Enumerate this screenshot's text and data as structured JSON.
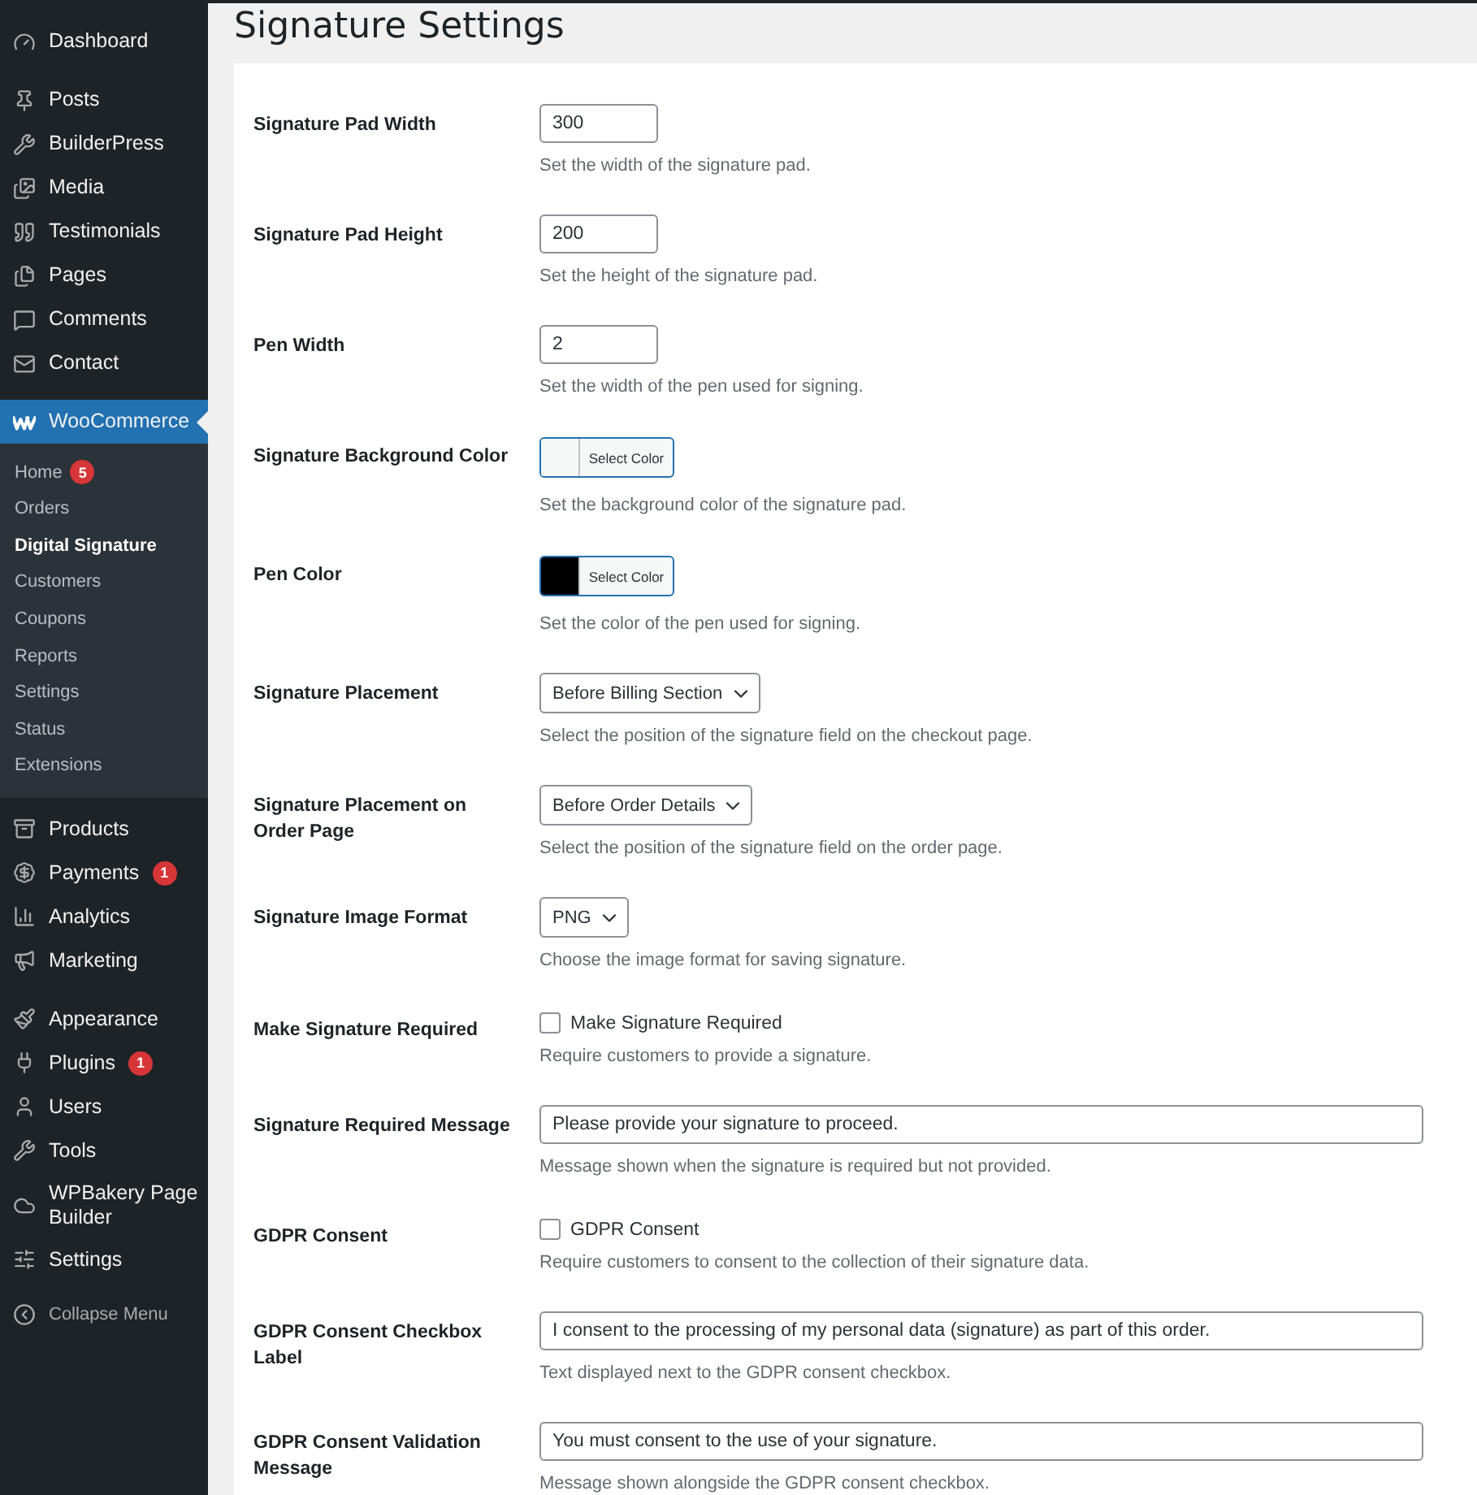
{
  "sidebar": {
    "groups": [
      [
        {
          "label": "Dashboard",
          "selected": false
        }
      ],
      [
        {
          "label": "Posts",
          "selected": false
        },
        {
          "label": "BuilderPress",
          "selected": false
        },
        {
          "label": "Media",
          "selected": false
        },
        {
          "label": "Testimonials",
          "selected": false
        },
        {
          "label": "Pages",
          "selected": false
        },
        {
          "label": "Comments",
          "selected": false
        },
        {
          "label": "Contact",
          "selected": false
        }
      ],
      [
        {
          "label": "WooCommerce",
          "selected": true,
          "children": [
            {
              "label": "Home",
              "badge": "5",
              "selected": false
            },
            {
              "label": "Orders",
              "selected": false
            },
            {
              "label": "Digital Signature",
              "selected": true
            },
            {
              "label": "Customers",
              "selected": false
            },
            {
              "label": "Coupons",
              "selected": false
            },
            {
              "label": "Reports",
              "selected": false
            },
            {
              "label": "Settings",
              "selected": false
            },
            {
              "label": "Status",
              "selected": false
            },
            {
              "label": "Extensions",
              "selected": false
            }
          ]
        },
        {
          "label": "Products",
          "selected": false
        },
        {
          "label": "Payments",
          "badge": "1",
          "selected": false
        },
        {
          "label": "Analytics",
          "selected": false
        },
        {
          "label": "Marketing",
          "selected": false
        }
      ],
      [
        {
          "label": "Appearance",
          "selected": false
        },
        {
          "label": "Plugins",
          "badge": "1",
          "selected": false
        },
        {
          "label": "Users",
          "selected": false
        },
        {
          "label": "Tools",
          "selected": false
        },
        {
          "label": "WPBakery Page Builder",
          "selected": false
        },
        {
          "label": "Settings",
          "selected": false
        }
      ]
    ],
    "collapse": "Collapse Menu"
  },
  "page": {
    "title": "Signature Settings"
  },
  "settings": [
    {
      "kind": "number",
      "label": "Signature Pad Width",
      "value": "300",
      "description": "Set the width of the signature pad."
    },
    {
      "kind": "number",
      "label": "Signature Pad Height",
      "value": "200",
      "description": "Set the height of the signature pad."
    },
    {
      "kind": "number",
      "label": "Pen Width",
      "value": "2",
      "description": "Set the width of the pen used for signing."
    },
    {
      "kind": "color",
      "label": "Signature Background Color",
      "button": "Select Color",
      "color": "#f6f7f7",
      "description": "Set the background color of the signature pad."
    },
    {
      "kind": "color",
      "label": "Pen Color",
      "button": "Select Color",
      "color": "#000000",
      "description": "Set the color of the pen used for signing."
    },
    {
      "kind": "select",
      "label": "Signature Placement",
      "value": "Before Billing Section",
      "description": "Select the position of the signature field on the checkout page."
    },
    {
      "kind": "select",
      "label": "Signature Placement on Order Page",
      "value": "Before Order Details",
      "description": "Select the position of the signature field on the order page."
    },
    {
      "kind": "select",
      "label": "Signature Image Format",
      "value": "PNG",
      "description": "Choose the image format for saving signature."
    },
    {
      "kind": "checkbox",
      "label": "Make Signature Required",
      "option": "Make Signature Required",
      "checked": false,
      "description": "Require customers to provide a signature."
    },
    {
      "kind": "text",
      "label": "Signature Required Message",
      "value": "Please provide your signature to proceed.",
      "description": "Message shown when the signature is required but not provided."
    },
    {
      "kind": "checkbox",
      "label": "GDPR Consent",
      "option": "GDPR Consent",
      "checked": false,
      "description": "Require customers to consent to the collection of their signature data."
    },
    {
      "kind": "text",
      "label": "GDPR Consent Checkbox Label",
      "value": "I consent to the processing of my personal data (signature) as part of this order.",
      "description": "Text displayed next to the GDPR consent checkbox."
    },
    {
      "kind": "text",
      "label": "GDPR Consent Validation Message",
      "value": "You must consent to the use of your signature.",
      "description": "Message shown alongside the GDPR consent checkbox."
    }
  ]
}
